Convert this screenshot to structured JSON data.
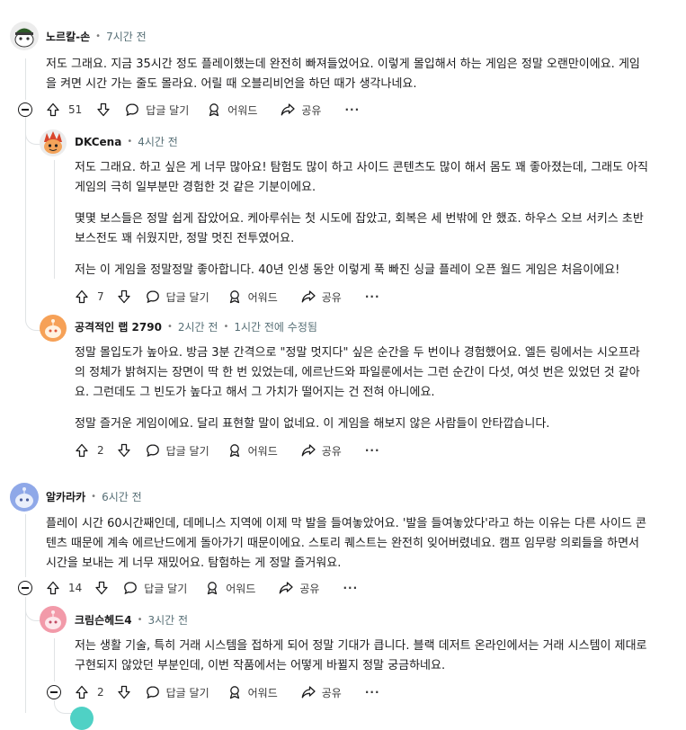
{
  "comments": [
    {
      "author": "노르칼-손",
      "time": "7시간 전",
      "paragraphs": [
        "저도 그래요. 지금 35시간 정도 플레이했는데 완전히 빠져들었어요. 이렇게 몰입해서 하는 게임은 정말 오랜만이에요. 게임을 켜면 시간 가는 줄도 몰라요. 어릴 때 오블리비언을 하던 때가 생각나네요."
      ],
      "votes": "51"
    },
    {
      "author": "DKCena",
      "time": "4시간 전",
      "paragraphs": [
        "저도 그래요. 하고 싶은 게 너무 많아요! 탐험도 많이 하고 사이드 콘텐츠도 많이 해서 몸도 꽤 좋아졌는데, 그래도 아직 게임의 극히 일부분만 경험한 것 같은 기분이에요.",
        "몇몇 보스들은 정말 쉽게 잡았어요. 케아루쉬는 첫 시도에 잡았고, 회복은 세 번밖에 안 했죠. 하우스 오브 서키스 초반 보스전도 꽤 쉬웠지만, 정말 멋진 전투였어요.",
        "저는 이 게임을 정말정말 좋아합니다. 40년 인생 동안 이렇게 푹 빠진 싱글 플레이 오픈 월드 게임은 처음이에요!"
      ],
      "votes": "7"
    },
    {
      "author": "공격적인 랩 2790",
      "time": "2시간 전",
      "edited": "1시간 전에 수정됨",
      "paragraphs": [
        "정말 몰입도가 높아요. 방금 3분 간격으로 \"정말 멋지다\" 싶은 순간을 두 번이나 경험했어요. 엘든 링에서는 시오프라의 정체가 밝혀지는 장면이 딱 한 번 있었는데, 에르난드와 파일룬에서는 그런 순간이 다섯, 여섯 번은 있었던 것 같아요. 그런데도 그 빈도가 높다고 해서 그 가치가 떨어지는 건 전혀 아니에요.",
        "정말 즐거운 게임이에요. 달리 표현할 말이 없네요. 이 게임을 해보지 않은 사람들이 안타깝습니다."
      ],
      "votes": "2"
    },
    {
      "author": "알카라카",
      "time": "6시간 전",
      "paragraphs": [
        "플레이 시간 60시간째인데, 데메니스 지역에 이제 막 발을 들여놓았어요. '발을 들여놓았다'라고 하는 이유는 다른 사이드 콘텐츠 때문에 계속 에르난드에게 돌아가기 때문이에요. 스토리 퀘스트는 완전히 잊어버렸네요. 캠프 임무랑 의뢰들을 하면서 시간을 보내는 게 너무 재밌어요. 탐험하는 게 정말 즐거워요."
      ],
      "votes": "14"
    },
    {
      "author": "크림슨헤드4",
      "time": "3시간 전",
      "paragraphs": [
        "저는 생활 기술, 특히 거래 시스템을 접하게 되어 정말 기대가 큽니다. 블랙 데저트 온라인에서는 거래 시스템이 제대로 구현되지 않았던 부분인데, 이번 작품에서는 어떻게 바뀔지 정말 궁금하네요."
      ],
      "votes": "2"
    }
  ],
  "labels": {
    "reply": "답글 달기",
    "award": "어워드",
    "share": "공유",
    "more": "···"
  },
  "icons": {
    "upvote": "upvote-arrow-icon",
    "downvote": "downvote-arrow-icon",
    "reply": "reply-bubble-icon",
    "award": "award-icon",
    "share": "share-arrow-icon",
    "collapse": "collapse-minus-icon"
  },
  "colors": {
    "avatar1": "#ececec",
    "avatar2": "#ececec",
    "avatar3": "#f6a157",
    "avatar4": "#8fa8e8",
    "avatar5": "#f29aa9",
    "avatar6": "#4fd1c5"
  }
}
